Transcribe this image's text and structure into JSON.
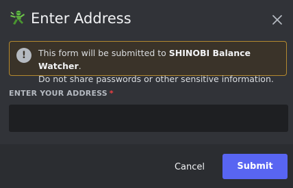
{
  "modal": {
    "title": "Enter Address",
    "app_icon": "green-ninja-emoji-icon",
    "close_icon": "close-icon"
  },
  "notice": {
    "icon": "exclamation-circle-icon",
    "prefix": "This form will be submitted to ",
    "app_name": "SHINOBI Balance Watcher",
    "suffix": ".",
    "line2": "Do not share passwords or other sensitive information."
  },
  "field": {
    "label": "ENTER YOUR ADDRESS",
    "required_marker": "*",
    "value": "",
    "placeholder": ""
  },
  "footer": {
    "cancel_label": "Cancel",
    "submit_label": "Submit"
  },
  "colors": {
    "background": "#313338",
    "footer": "#2b2d31",
    "input": "#1e1f22",
    "warning_border": "#b58a2f",
    "accent": "#5865f2",
    "required": "#f23f42"
  }
}
